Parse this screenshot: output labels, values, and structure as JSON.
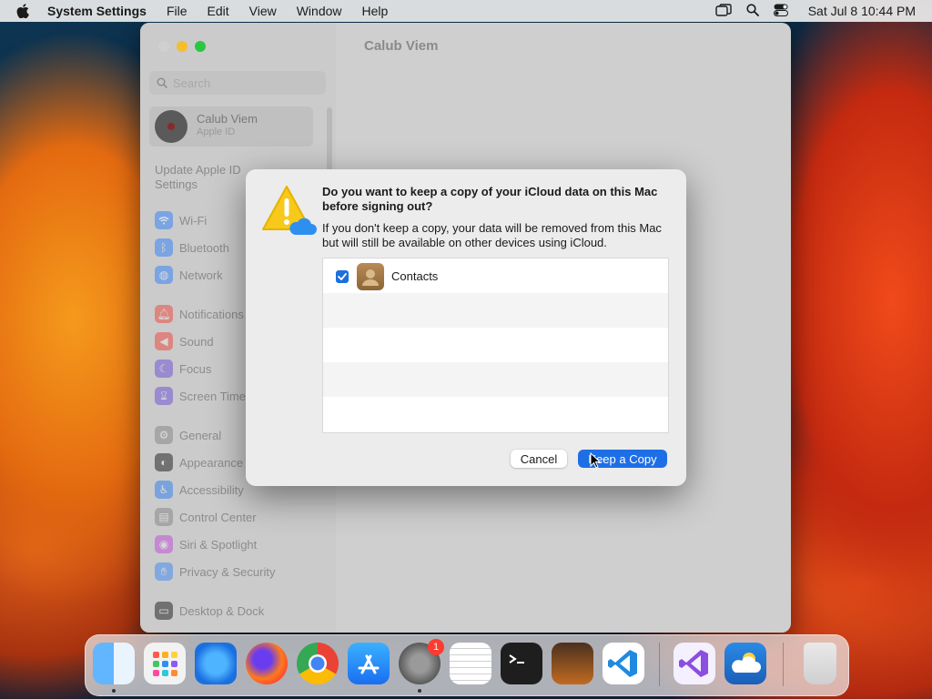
{
  "menubar": {
    "app_name": "System Settings",
    "items": [
      "File",
      "Edit",
      "View",
      "Window",
      "Help"
    ],
    "datetime": "Sat Jul 8  10:44 PM"
  },
  "window": {
    "title": "Calub Viem",
    "search_placeholder": "Search",
    "account": {
      "name": "Calub Viem",
      "subtitle": "Apple ID"
    },
    "update_notice": "Update Apple ID Settings",
    "sidebar": [
      {
        "label": "Wi-Fi",
        "icon": "wifi-icon",
        "color": "#3b86f5"
      },
      {
        "label": "Bluetooth",
        "icon": "bluetooth-icon",
        "color": "#3b86f5"
      },
      {
        "label": "Network",
        "icon": "network-icon",
        "color": "#3b86f5"
      },
      {
        "label": "Notifications",
        "icon": "notifications-icon",
        "color": "#f0443a"
      },
      {
        "label": "Sound",
        "icon": "sound-icon",
        "color": "#f0443a"
      },
      {
        "label": "Focus",
        "icon": "focus-icon",
        "color": "#6a4bd6"
      },
      {
        "label": "Screen Time",
        "icon": "screen-time-icon",
        "color": "#6a4bd6"
      },
      {
        "label": "General",
        "icon": "general-icon",
        "color": "#8e8e8e"
      },
      {
        "label": "Appearance",
        "icon": "appearance-icon",
        "color": "#1a1a1a"
      },
      {
        "label": "Accessibility",
        "icon": "accessibility-icon",
        "color": "#2a7cf0"
      },
      {
        "label": "Control Center",
        "icon": "control-center-icon",
        "color": "#8e8e8e"
      },
      {
        "label": "Siri & Spotlight",
        "icon": "siri-icon",
        "color": "#c04ad6"
      },
      {
        "label": "Privacy & Security",
        "icon": "privacy-icon",
        "color": "#3b86f5"
      },
      {
        "label": "Desktop & Dock",
        "icon": "desktop-dock-icon",
        "color": "#1a1a1a"
      }
    ]
  },
  "dialog": {
    "title": "Do you want to keep a copy of your iCloud data on this Mac before signing out?",
    "message": "If you don't keep a copy, your data will be removed from this Mac but will still be available on other devices using iCloud.",
    "items": [
      {
        "label": "Contacts",
        "checked": true
      }
    ],
    "cancel_label": "Cancel",
    "keep_label": "Keep a Copy"
  },
  "dock": {
    "apps": [
      "Finder",
      "Launchpad",
      "Safari",
      "Firefox",
      "Chrome",
      "App Store",
      "System Settings",
      "TextEdit",
      "Terminal",
      "GarageBand",
      "Visual Studio Code",
      "Visual Studio",
      "Weather",
      "Trash"
    ],
    "settings_badge": "1"
  }
}
